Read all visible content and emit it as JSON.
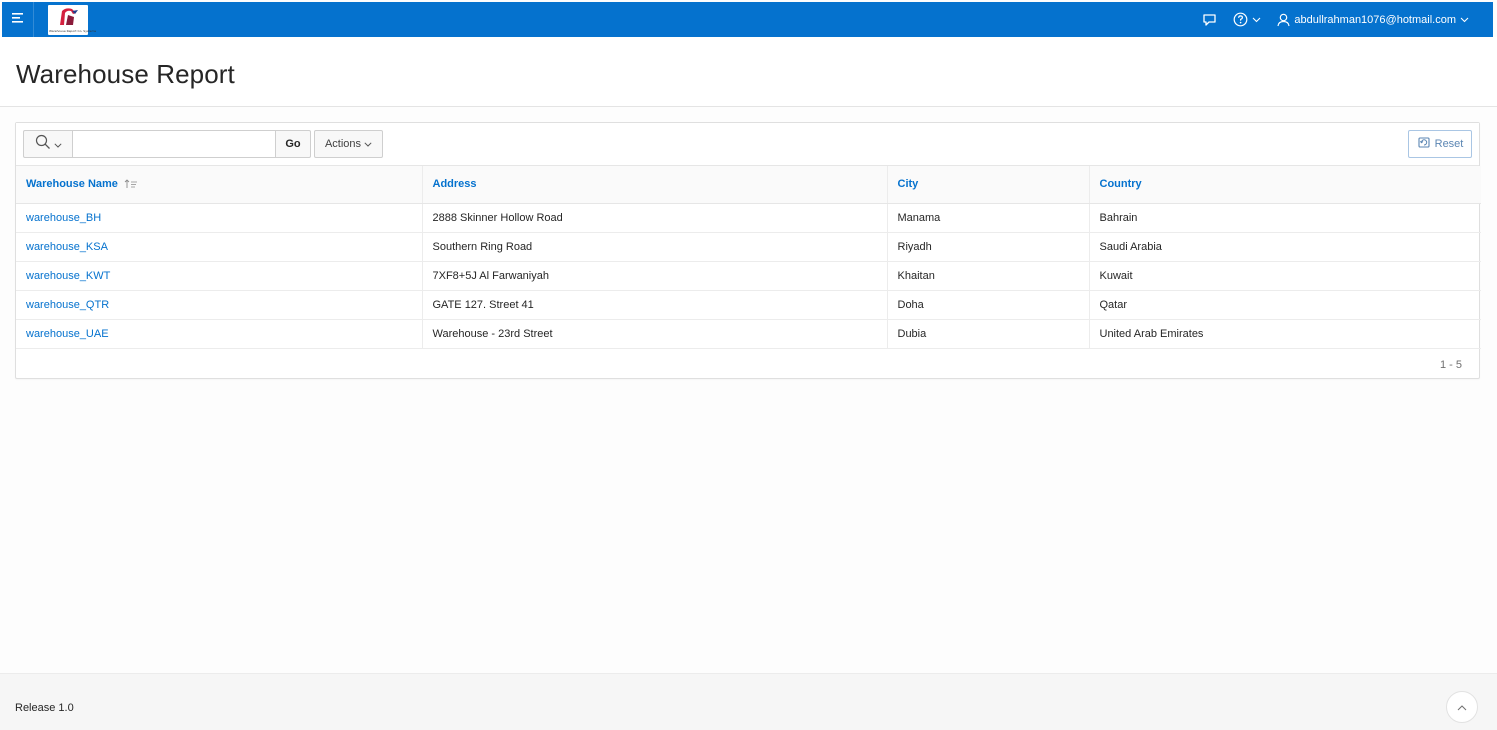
{
  "header": {
    "logo_text": "Warehouse Report Co. Systems",
    "user": "abdullrahman1076@hotmail.com"
  },
  "page": {
    "title": "Warehouse Report"
  },
  "toolbar": {
    "search_placeholder": "",
    "go_label": "Go",
    "actions_label": "Actions",
    "reset_label": "Reset"
  },
  "table": {
    "columns": [
      "Warehouse Name",
      "Address",
      "City",
      "Country"
    ],
    "rows": [
      [
        "warehouse_BH",
        "2888 Skinner Hollow Road",
        "Manama",
        "Bahrain"
      ],
      [
        "warehouse_KSA",
        "Southern Ring Road",
        "Riyadh",
        "Saudi Arabia"
      ],
      [
        "warehouse_KWT",
        "7XF8+5J Al Farwaniyah",
        "Khaitan",
        "Kuwait"
      ],
      [
        "warehouse_QTR",
        "GATE 127. Street 41",
        "Doha",
        "Qatar"
      ],
      [
        "warehouse_UAE",
        "Warehouse - 23rd Street",
        "Dubia",
        "United Arab Emirates"
      ]
    ]
  },
  "pagination": {
    "range": "1 - 5"
  },
  "footer": {
    "release": "Release 1.0"
  },
  "colors": {
    "header_bg": "#0572ce",
    "link": "#0572ce"
  }
}
